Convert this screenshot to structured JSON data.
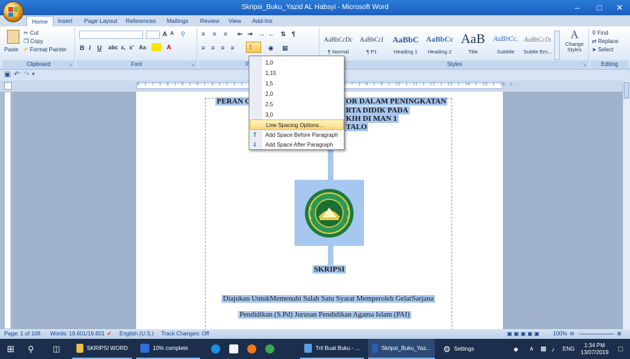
{
  "window": {
    "title": "Skripsi_Buku_Yazid AL Habsyi - Microsoft Word"
  },
  "tabs": [
    "Home",
    "Insert",
    "Page Layout",
    "References",
    "Mailings",
    "Review",
    "View",
    "Add-Ins"
  ],
  "clipboard": {
    "cut": "Cut",
    "copy": "Copy",
    "format_painter": "Format Painter",
    "paste": "Paste",
    "label": "Clipboard"
  },
  "font_group": {
    "label": "Font",
    "grow": "A",
    "shrink": "A"
  },
  "paragraph_group": {
    "label": "Paragraph"
  },
  "styles": {
    "label": "Styles",
    "items": [
      {
        "sample": "AaBbCcDc",
        "name": "¶ Normal"
      },
      {
        "sample": "AaBbCcI",
        "name": "¶ P1"
      },
      {
        "sample": "AaBbC",
        "name": "Heading 1"
      },
      {
        "sample": "AaBbCc",
        "name": "Heading 2"
      },
      {
        "sample": "AaB",
        "name": "Title"
      },
      {
        "sample": "AaBbCc.",
        "name": "Subtitle"
      },
      {
        "sample": "AaBbCcDı",
        "name": "Subtle Em..."
      }
    ],
    "change": "Change Styles"
  },
  "editing": {
    "label": "Editing",
    "find": "Find",
    "replace": "Replace",
    "select": "Select"
  },
  "ruler": {
    "text": "8 · 1 · 7 · 1 · 6 · 1 · 5 · 1 · 4 · 1 · 3 · 1 · 2 · 1 · 1 · 1 · · · 1 · 1 · 2 · 1 · 3 · 1 · 4 · 1 · 5 · 1 · 6 · 1 · 7 · 1 · 8 · 1 · 9 · 1 · 10 · 1 · 11 · 1 · 12 · 1 · 13 · 1 · 14 · 1 · 15 · 1 · 16 · 1 ·"
  },
  "line_spacing_menu": {
    "values": [
      "1,0",
      "1,15",
      "1,5",
      "2,0",
      "2,5",
      "3,0"
    ],
    "options": "Line Spacing Options...",
    "before": "Add Space Before Paragraph",
    "after": "Add Space After Paragraph"
  },
  "document": {
    "title_line1_left": "PERAN G",
    "title_line1_right": "OR DALAM PENINGKATAN",
    "title_line2": "RTA DIDIK PADA",
    "title_line3": "KIH DI MAN 1",
    "title_line4": "TALO",
    "heading": "SKRIPSI",
    "body_line1": "Diajukan UntukMemenuhi Salah Satu Syarat Memperoleh GelarSarjana",
    "body_line2": "Pendidikan (S.Pd) Jurusan Pendidikan Agama Islam (PAI)"
  },
  "status": {
    "page": "Page: 1 of 108",
    "words": "Words: 19.601/19.601",
    "language": "English (U.S.)",
    "track": "Track Changes: Off",
    "zoom": "100%"
  },
  "taskbar": {
    "apps": [
      {
        "label": "SKRIPSI WORD",
        "color": "#f0c040"
      },
      {
        "label": "10% complete",
        "color": "#2f6fd6"
      },
      {
        "label": "",
        "color": "#1f8fe6"
      },
      {
        "label": "",
        "color": "#f2f2f2"
      },
      {
        "label": "",
        "color": "#f07a1a"
      },
      {
        "label": "",
        "color": "#3aa84a"
      },
      {
        "label": "Tril Buat Buku - ...",
        "color": "#5a9de0"
      },
      {
        "label": "Skripsi_Buku_Yaz...",
        "color": "#2b5fb8"
      },
      {
        "label": "Settings",
        "color": "#ffffff"
      }
    ],
    "lang": "ENG",
    "time": "1:34 PM",
    "date": "13/07/2019"
  }
}
